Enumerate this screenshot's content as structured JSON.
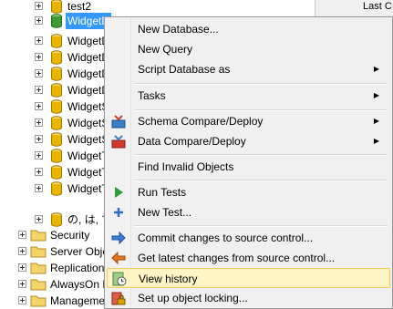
{
  "tree": {
    "items": [
      {
        "label": "test2"
      },
      {
        "label": "WidgetD"
      },
      {
        "label": "WidgetD"
      },
      {
        "label": "WidgetD"
      },
      {
        "label": "WidgetD"
      },
      {
        "label": "WidgetD"
      },
      {
        "label": "WidgetS"
      },
      {
        "label": "WidgetS"
      },
      {
        "label": "WidgetS"
      },
      {
        "label": "WidgetT"
      },
      {
        "label": "WidgetT"
      },
      {
        "label": "WidgetT"
      },
      {
        "label": "の, は, で"
      }
    ],
    "folders": [
      {
        "label": "Security"
      },
      {
        "label": "Server Obje"
      },
      {
        "label": "Replication"
      },
      {
        "label": "AlwaysOn H"
      },
      {
        "label": "Manageme"
      }
    ],
    "right_strip_text": "Last C"
  },
  "menu": {
    "items": [
      {
        "label": "New Database...",
        "arrow": ""
      },
      {
        "label": "New Query",
        "arrow": ""
      },
      {
        "label": "Script Database as",
        "arrow": "▶"
      },
      {
        "label": "Tasks",
        "arrow": "▶"
      },
      {
        "label": "Schema Compare/Deploy",
        "arrow": "▶"
      },
      {
        "label": "Data Compare/Deploy",
        "arrow": "▶"
      },
      {
        "label": "Find Invalid Objects",
        "arrow": ""
      },
      {
        "label": "Run Tests",
        "arrow": ""
      },
      {
        "label": "New Test...",
        "arrow": ""
      },
      {
        "label": "Commit changes to source control...",
        "arrow": ""
      },
      {
        "label": "Get latest changes from source control...",
        "arrow": ""
      },
      {
        "label": "View history",
        "arrow": ""
      },
      {
        "label": "Set up object locking...",
        "arrow": ""
      }
    ]
  },
  "colors": {
    "selection": "#3399ff",
    "highlight_bg": "#fff4c4",
    "highlight_border": "#f2ca58",
    "db_gold": "#e8b400",
    "db_green": "#3f9c35"
  }
}
